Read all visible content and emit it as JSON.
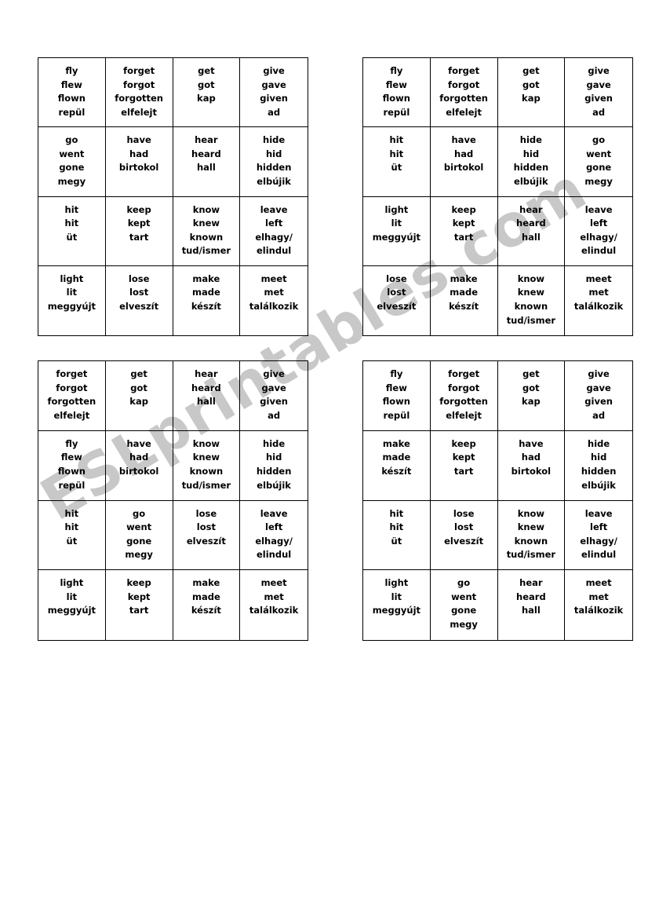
{
  "document": {
    "type": "irregular-verbs-bingo-worksheet",
    "watermark": "ESLprintables.com",
    "watermark_color": "#c6c6c6"
  },
  "cards": [
    {
      "id": "card-1",
      "position": "top-left",
      "cells": [
        [
          "fly",
          "flew",
          "flown",
          "repül"
        ],
        [
          "forget",
          "forgot",
          "forgotten",
          "elfelejt"
        ],
        [
          "get",
          "got",
          "kap"
        ],
        [
          "give",
          "gave",
          "given",
          "ad"
        ],
        [
          "go",
          "went",
          "gone",
          "megy"
        ],
        [
          "have",
          "had",
          "birtokol"
        ],
        [
          "hear",
          "heard",
          "hall"
        ],
        [
          "hide",
          "hid",
          "hidden",
          "elbújik"
        ],
        [
          "hit",
          "hit",
          "üt"
        ],
        [
          "keep",
          "kept",
          "tart"
        ],
        [
          "know",
          "knew",
          "known",
          "tud/ismer"
        ],
        [
          "leave",
          "left",
          "elhagy/",
          "elindul"
        ],
        [
          "light",
          "lit",
          "meggyújt"
        ],
        [
          "lose",
          "lost",
          "elveszít"
        ],
        [
          "make",
          "made",
          "készít"
        ],
        [
          "meet",
          "met",
          "találkozik"
        ]
      ]
    },
    {
      "id": "card-2",
      "position": "top-right",
      "cells": [
        [
          "fly",
          "flew",
          "flown",
          "repül"
        ],
        [
          "forget",
          "forgot",
          "forgotten",
          "elfelejt"
        ],
        [
          "get",
          "got",
          "kap"
        ],
        [
          "give",
          "gave",
          "given",
          "ad"
        ],
        [
          "hit",
          "hit",
          "üt"
        ],
        [
          "have",
          "had",
          "birtokol"
        ],
        [
          "hide",
          "hid",
          "hidden",
          "elbújik"
        ],
        [
          "go",
          "went",
          "gone",
          "megy"
        ],
        [
          "light",
          "lit",
          "meggyújt"
        ],
        [
          "keep",
          "kept",
          "tart"
        ],
        [
          "hear",
          "heard",
          "hall"
        ],
        [
          "leave",
          "left",
          "elhagy/",
          "elindul"
        ],
        [
          "lose",
          "lost",
          "elveszít"
        ],
        [
          "make",
          "made",
          "készít"
        ],
        [
          "know",
          "knew",
          "known",
          "tud/ismer"
        ],
        [
          "meet",
          "met",
          "találkozik"
        ]
      ]
    },
    {
      "id": "card-3",
      "position": "bottom-left",
      "cells": [
        [
          "forget",
          "forgot",
          "forgotten",
          "elfelejt"
        ],
        [
          "get",
          "got",
          "kap"
        ],
        [
          "hear",
          "heard",
          "hall"
        ],
        [
          "give",
          "gave",
          "given",
          "ad"
        ],
        [
          "fly",
          "flew",
          "flown",
          "repül"
        ],
        [
          "have",
          "had",
          "birtokol"
        ],
        [
          "know",
          "knew",
          "known",
          "tud/ismer"
        ],
        [
          "hide",
          "hid",
          "hidden",
          "elbújik"
        ],
        [
          "hit",
          "hit",
          "üt"
        ],
        [
          "go",
          "went",
          "gone",
          "megy"
        ],
        [
          "lose",
          "lost",
          "elveszít"
        ],
        [
          "leave",
          "left",
          "elhagy/",
          "elindul"
        ],
        [
          "light",
          "lit",
          "meggyújt"
        ],
        [
          "keep",
          "kept",
          "tart"
        ],
        [
          "make",
          "made",
          "készít"
        ],
        [
          "meet",
          "met",
          "találkozik"
        ]
      ]
    },
    {
      "id": "card-4",
      "position": "bottom-right",
      "cells": [
        [
          "fly",
          "flew",
          "flown",
          "repül"
        ],
        [
          "forget",
          "forgot",
          "forgotten",
          "elfelejt"
        ],
        [
          "get",
          "got",
          "kap"
        ],
        [
          "give",
          "gave",
          "given",
          "ad"
        ],
        [
          "make",
          "made",
          "készít"
        ],
        [
          "keep",
          "kept",
          "tart"
        ],
        [
          "have",
          "had",
          "birtokol"
        ],
        [
          "hide",
          "hid",
          "hidden",
          "elbújik"
        ],
        [
          "hit",
          "hit",
          "üt"
        ],
        [
          "lose",
          "lost",
          "elveszít"
        ],
        [
          "know",
          "knew",
          "known",
          "tud/ismer"
        ],
        [
          "leave",
          "left",
          "elhagy/",
          "elindul"
        ],
        [
          "light",
          "lit",
          "meggyújt"
        ],
        [
          "go",
          "went",
          "gone",
          "megy"
        ],
        [
          "hear",
          "heard",
          "hall"
        ],
        [
          "meet",
          "met",
          "találkozik"
        ]
      ]
    }
  ]
}
